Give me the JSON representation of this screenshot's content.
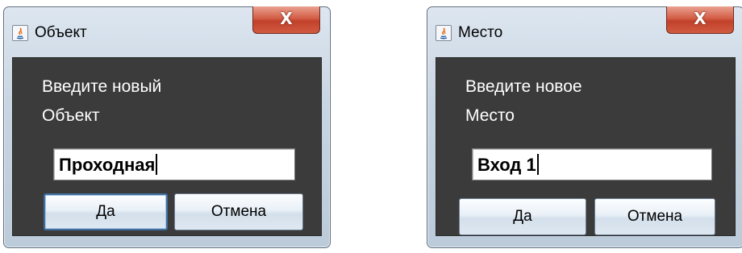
{
  "dialogs": [
    {
      "title": "Объект",
      "close_label": "X",
      "app_icon": "java-icon",
      "message_line1": "Введите новый",
      "message_line2": "Объект",
      "input_value": "Проходная",
      "ok_label": "Да",
      "cancel_label": "Отмена"
    },
    {
      "title": "Место",
      "close_label": "X",
      "app_icon": "java-icon",
      "message_line1": "Введите новое",
      "message_line2": "Место",
      "input_value": "Вход 1",
      "ok_label": "Да",
      "cancel_label": "Отмена"
    }
  ],
  "colors": {
    "content_bg": "#3b3b3b",
    "message_text": "#ffffff",
    "close_button": "#c7442d"
  }
}
